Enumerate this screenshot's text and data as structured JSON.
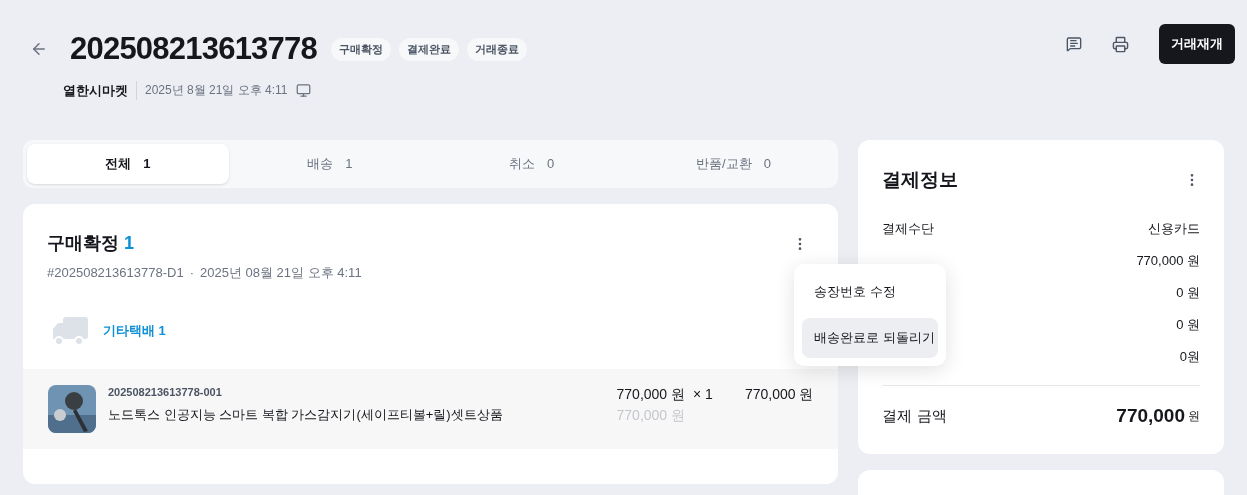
{
  "header": {
    "order_number": "202508213613778",
    "badges": [
      "구매확정",
      "결제완료",
      "거래종료"
    ],
    "store": "열한시마켓",
    "date": "2025년 8월 21일 오후 4:11",
    "action_button": "거래재개"
  },
  "tabs": [
    {
      "label": "전체",
      "count": "1",
      "selected": true
    },
    {
      "label": "배송",
      "count": "1",
      "selected": false
    },
    {
      "label": "취소",
      "count": "0",
      "selected": false
    },
    {
      "label": "반품/교환",
      "count": "0",
      "selected": false
    }
  ],
  "order_group": {
    "status": "구매확정",
    "count": "1",
    "sub_number": "#202508213613778-D1",
    "separator": "·",
    "date": "2025년 08월 21일 오후 4:11",
    "carrier": "기타택배 1",
    "items": [
      {
        "code": "202508213613778-001",
        "name": "노드톡스 인공지능 스마트 복합 가스감지기(세이프티볼+릴)셋트상품",
        "price": "770,000 원",
        "quantity": "× 1",
        "original_price": "770,000 원",
        "total": "770,000 원"
      }
    ]
  },
  "context_menu": {
    "items": [
      {
        "label": "송장번호 수정",
        "selected": false
      },
      {
        "label": "배송완료로 되돌리기",
        "selected": true
      }
    ]
  },
  "payment": {
    "title": "결제정보",
    "rows": [
      {
        "label": "결제수단",
        "value": "신용카드"
      },
      {
        "value": "770,000 원"
      },
      {
        "value": "0 원"
      },
      {
        "value": "0 원"
      },
      {
        "value": "0원"
      }
    ],
    "total_label": "결제 금액",
    "total_amount": "770,000",
    "total_unit": "원"
  }
}
